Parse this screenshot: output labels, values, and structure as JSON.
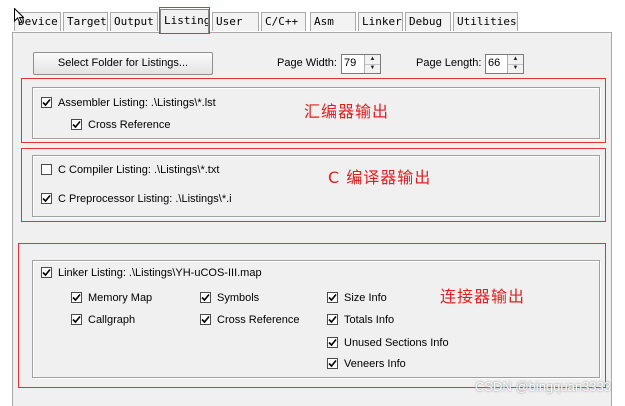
{
  "tabs": [
    {
      "label": "Device",
      "active": false
    },
    {
      "label": "Target",
      "active": false
    },
    {
      "label": "Output",
      "active": false
    },
    {
      "label": "Listing",
      "active": true
    },
    {
      "label": "User",
      "active": false
    },
    {
      "label": "C/C++",
      "active": false
    },
    {
      "label": "Asm",
      "active": false
    },
    {
      "label": "Linker",
      "active": false
    },
    {
      "label": "Debug",
      "active": false
    },
    {
      "label": "Utilities",
      "active": false
    }
  ],
  "select_folder_label": "Select Folder for Listings...",
  "page_width": {
    "label": "Page Width:",
    "value": "79"
  },
  "page_length": {
    "label": "Page Length:",
    "value": "66"
  },
  "assembler": {
    "listing_label": "Assembler Listing:  .\\Listings\\*.lst",
    "listing_checked": true,
    "cross_reference_label": "Cross Reference",
    "cross_reference_checked": true,
    "annotation": "汇编器输出"
  },
  "compiler": {
    "c_compiler_label": "C Compiler Listing:  .\\Listings\\*.txt",
    "c_compiler_checked": false,
    "c_preprocessor_label": "C Preprocessor Listing:  .\\Listings\\*.i",
    "c_preprocessor_checked": true,
    "annotation": "C  编译器输出"
  },
  "linker": {
    "listing_label": "Linker Listing:  .\\Listings\\YH-uCOS-III.map",
    "listing_checked": true,
    "memory_map": "Memory Map",
    "symbols": "Symbols",
    "size_info": "Size Info",
    "callgraph": "Callgraph",
    "cross_reference": "Cross Reference",
    "totals_info": "Totals Info",
    "unused_sections_info": "Unused Sections Info",
    "veneers_info": "Veneers Info",
    "annotation": "连接器输出"
  },
  "watermark": "CSDN @bingquan3333",
  "colors": {
    "annotation_red": "#e63030",
    "panel_bg": "#f0f0f0"
  }
}
